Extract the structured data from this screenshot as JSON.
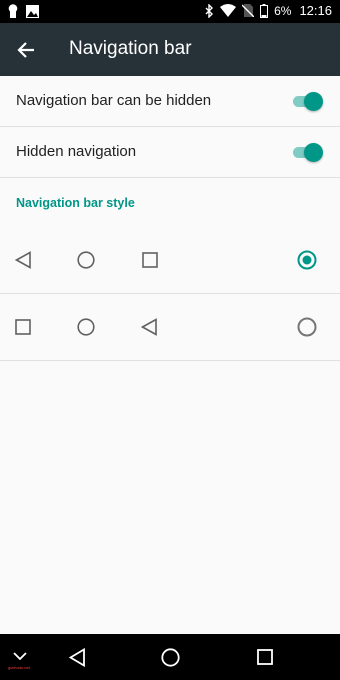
{
  "status_bar": {
    "battery": "6%",
    "time": "12:16",
    "icons": [
      "keyhole-icon",
      "image-icon",
      "bluetooth-icon",
      "wifi-icon",
      "no-sim-icon",
      "battery-icon"
    ]
  },
  "toolbar": {
    "title": "Navigation bar",
    "back_icon": "arrow-left-icon"
  },
  "settings": [
    {
      "label": "Navigation bar can be hidden",
      "enabled": true
    },
    {
      "label": "Hidden navigation",
      "enabled": true
    }
  ],
  "section": {
    "title": "Navigation bar style"
  },
  "styles": [
    {
      "buttons": [
        "back-triangle",
        "home-circle",
        "recents-square"
      ],
      "selected": true
    },
    {
      "buttons": [
        "recents-square",
        "home-circle",
        "back-triangle"
      ],
      "selected": false
    }
  ],
  "accent_color": "#009688",
  "nav_bar": {
    "buttons": [
      "chevron-down-icon",
      "back-icon",
      "home-icon",
      "recents-icon"
    ],
    "watermark": "gizmodo.net"
  }
}
